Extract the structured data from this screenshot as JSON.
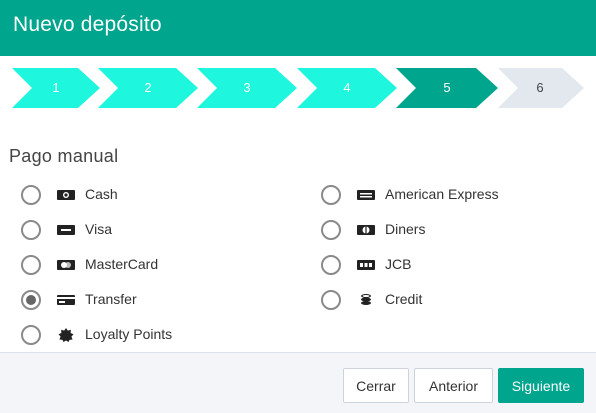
{
  "header": {
    "title": "Nuevo depósito"
  },
  "stepper": {
    "steps": [
      {
        "label": "1",
        "state": "done"
      },
      {
        "label": "2",
        "state": "done"
      },
      {
        "label": "3",
        "state": "done"
      },
      {
        "label": "4",
        "state": "done"
      },
      {
        "label": "5",
        "state": "active"
      },
      {
        "label": "6",
        "state": "pending"
      }
    ],
    "colors": {
      "done": "#1ef6de",
      "active": "#00a58e",
      "pending": "#e2e8ee"
    }
  },
  "section": {
    "title": "Pago manual"
  },
  "payment_methods": [
    {
      "label": "Cash",
      "icon": "cash-icon",
      "selected": false
    },
    {
      "label": "American Express",
      "icon": "amex-card-icon",
      "selected": false
    },
    {
      "label": "Visa",
      "icon": "visa-card-icon",
      "selected": false
    },
    {
      "label": "Diners",
      "icon": "diners-card-icon",
      "selected": false
    },
    {
      "label": "MasterCard",
      "icon": "mastercard-icon",
      "selected": false
    },
    {
      "label": "JCB",
      "icon": "jcb-card-icon",
      "selected": false
    },
    {
      "label": "Transfer",
      "icon": "transfer-card-icon",
      "selected": true
    },
    {
      "label": "Credit",
      "icon": "coins-icon",
      "selected": false
    },
    {
      "label": "Loyalty Points",
      "icon": "loyalty-badge-icon",
      "selected": false
    }
  ],
  "footer": {
    "close_label": "Cerrar",
    "previous_label": "Anterior",
    "next_label": "Siguiente"
  },
  "colors": {
    "accent": "#00a58e"
  }
}
